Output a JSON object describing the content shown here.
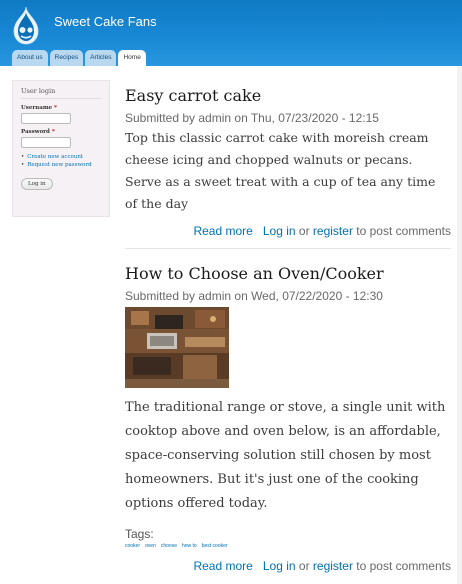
{
  "site": {
    "name": "Sweet Cake Fans"
  },
  "nav": {
    "tabs": [
      "About us",
      "Recipes",
      "Articles",
      "Home"
    ]
  },
  "login": {
    "title": "User login",
    "username_label": "Username",
    "password_label": "Password",
    "required_mark": "*",
    "create_account": "Create new account",
    "request_password": "Request new password",
    "button": "Log in"
  },
  "nodes": [
    {
      "title": "Easy carrot cake",
      "submitted": "Submitted by admin on Thu, 07/23/2020 - 12:15",
      "body": "Top this classic carrot cake with moreish cream cheese icing and chopped walnuts or pecans. Serve as a sweet treat with a cup of tea any time of the day",
      "read_more": "Read more",
      "login": "Log in",
      "or": "or",
      "register": "register",
      "suffix": "to post comments"
    },
    {
      "title": "How to Choose an Oven/Cooker",
      "submitted": "Submitted by admin on Wed, 07/22/2020 - 12:30",
      "body": "The traditional range or stove, a single unit with cooktop above and oven below, is an affordable, space-conserving solution still chosen by most homeowners. But it's just one of the cooking options offered today.",
      "tags_label": "Tags:",
      "tags": [
        "cooker",
        "oven",
        "choose",
        "how to",
        "best cooker"
      ],
      "read_more": "Read more",
      "login": "Log in",
      "or": "or",
      "register": "register",
      "suffix": "to post comments"
    }
  ],
  "colors": {
    "header": "#1a8ad6",
    "link": "#0071b3"
  },
  "icons": {
    "logo": "drupal-drop-logo",
    "image": "kitchen-photo"
  }
}
